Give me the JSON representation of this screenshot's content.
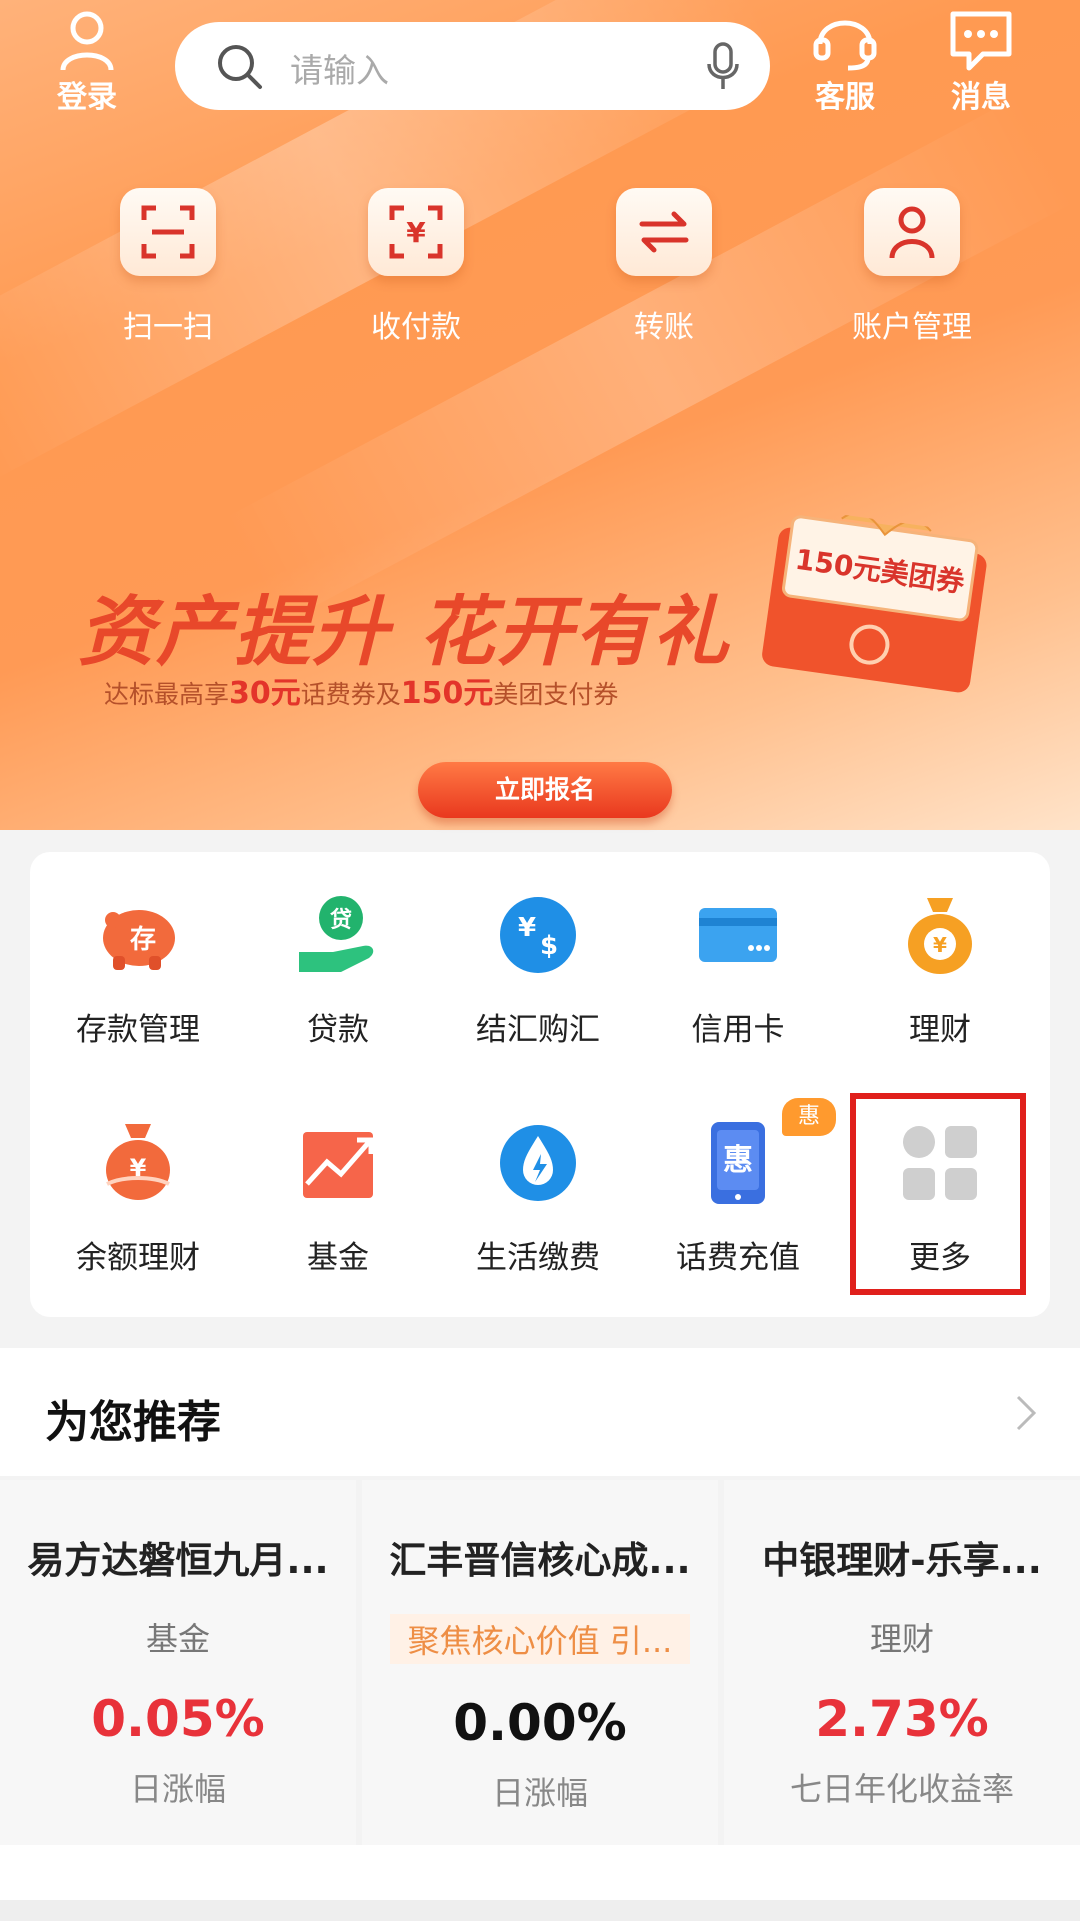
{
  "topbar": {
    "login_label": "登录",
    "search_placeholder": "请输入",
    "service_label": "客服",
    "message_label": "消息"
  },
  "quick_actions": [
    {
      "label": "扫一扫",
      "icon": "scan-icon"
    },
    {
      "label": "收付款",
      "icon": "payment-code-icon"
    },
    {
      "label": "转账",
      "icon": "transfer-icon"
    },
    {
      "label": "账户管理",
      "icon": "account-icon"
    }
  ],
  "banner": {
    "title": "资产提升 花开有礼",
    "sub_prefix": "达标最高享",
    "sub_amount1": "30元",
    "sub_mid": "话费券及",
    "sub_amount2": "150元",
    "sub_suffix": "美团支付券",
    "coupon_text": "150元美团券",
    "button": "立即报名"
  },
  "services": [
    {
      "label": "存款管理",
      "icon": "piggy-bank-icon"
    },
    {
      "label": "贷款",
      "icon": "loan-icon"
    },
    {
      "label": "结汇购汇",
      "icon": "exchange-icon"
    },
    {
      "label": "信用卡",
      "icon": "credit-card-icon"
    },
    {
      "label": "理财",
      "icon": "money-bag-icon"
    },
    {
      "label": "余额理财",
      "icon": "balance-bag-icon"
    },
    {
      "label": "基金",
      "icon": "fund-chart-icon"
    },
    {
      "label": "生活缴费",
      "icon": "utility-icon"
    },
    {
      "label": "话费充值",
      "icon": "phone-recharge-icon",
      "badge": "惠"
    },
    {
      "label": "更多",
      "icon": "more-grid-icon"
    }
  ],
  "recommend": {
    "title": "为您推荐",
    "products": [
      {
        "name": "易方达磐恒九月...",
        "type": "基金",
        "value": "0.05%",
        "value_label": "日涨幅",
        "color": "#e8323a"
      },
      {
        "name": "汇丰晋信核心成...",
        "tag": "聚焦核心价值 引...",
        "value": "0.00%",
        "value_label": "日涨幅",
        "color": "#111111"
      },
      {
        "name": "中银理财-乐享...",
        "type": "理财",
        "value": "2.73%",
        "value_label": "七日年化收益率",
        "color": "#e8323a"
      }
    ]
  },
  "colors": {
    "accent": "#ff9a52",
    "highlight_red": "#e0201c"
  }
}
